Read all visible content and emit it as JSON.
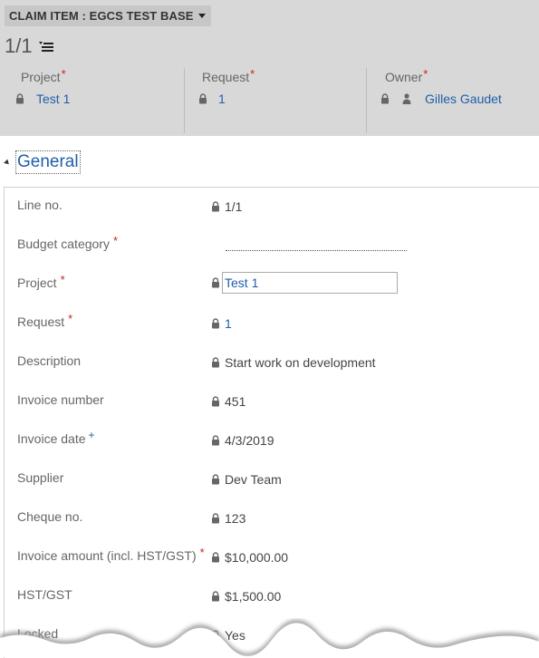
{
  "header": {
    "entity_title": "CLAIM ITEM : EGCS TEST BASE",
    "record_counter": "1/1",
    "fields": [
      {
        "label": "Project",
        "required": "*",
        "value": "Test 1"
      },
      {
        "label": "Request",
        "required": "*",
        "value": "1"
      },
      {
        "label": "Owner",
        "required": "*",
        "value": "Gilles Gaudet"
      }
    ]
  },
  "section": {
    "title": "General"
  },
  "form": [
    {
      "label": "Line no.",
      "marker": "",
      "value": "1/1"
    },
    {
      "label": "Budget category",
      "marker": "*",
      "value": ""
    },
    {
      "label": "Project",
      "marker": "*",
      "value": "Test 1"
    },
    {
      "label": "Request",
      "marker": "*",
      "value": "1"
    },
    {
      "label": "Description",
      "marker": "",
      "value": "Start work on development"
    },
    {
      "label": "Invoice number",
      "marker": "",
      "value": "451"
    },
    {
      "label": "Invoice date",
      "marker": "+",
      "value": "4/3/2019"
    },
    {
      "label": "Supplier",
      "marker": "",
      "value": "Dev Team"
    },
    {
      "label": "Cheque no.",
      "marker": "",
      "value": "123"
    },
    {
      "label": "Invoice amount (incl. HST/GST)",
      "marker": "*",
      "value": "$10,000.00"
    },
    {
      "label": "HST/GST",
      "marker": "",
      "value": "$1,500.00"
    },
    {
      "label": "Locked",
      "marker": "",
      "value": "Yes"
    }
  ],
  "colors": {
    "header_bg": "#d8d8d8",
    "link": "#1f5fa8",
    "required": "#cc1f1f"
  }
}
